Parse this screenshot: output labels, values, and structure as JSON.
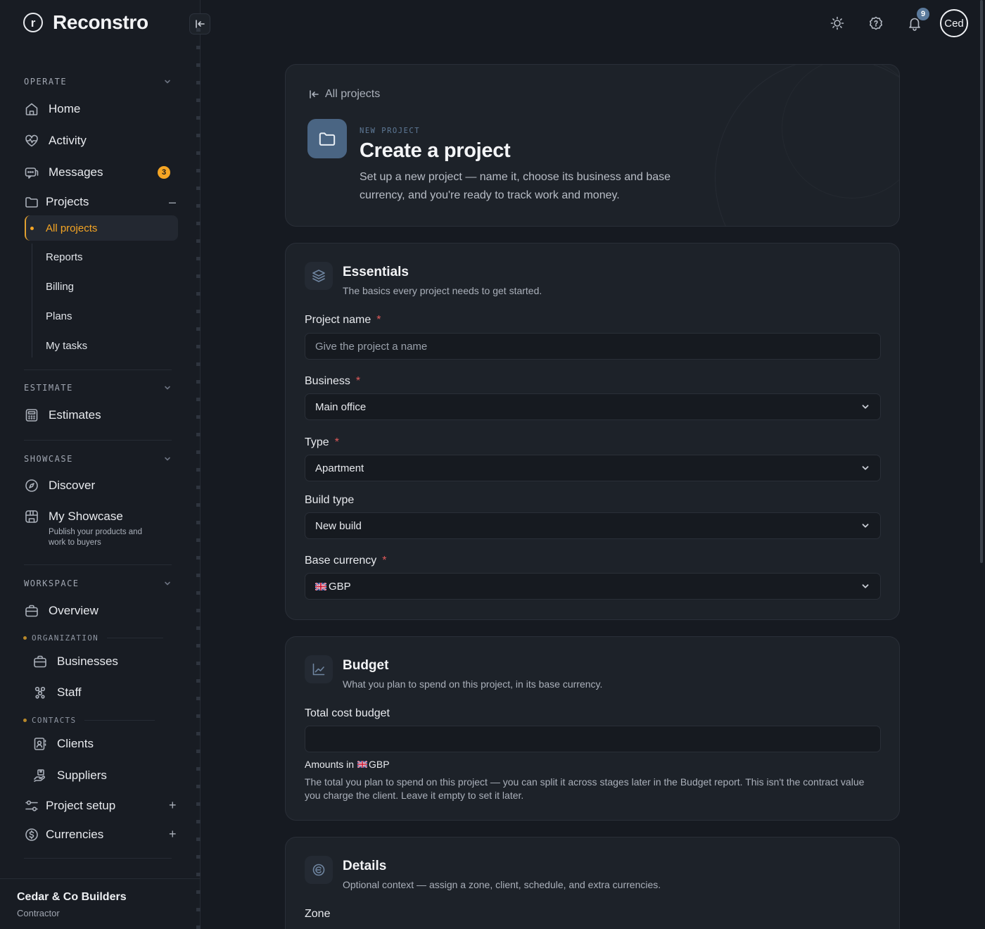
{
  "brand": {
    "name": "Reconstro",
    "logo_letter": "r"
  },
  "sidebar": {
    "sections": {
      "operate": "OPERATE",
      "estimate": "ESTIMATE",
      "showcase": "SHOWCASE",
      "workspace": "WORKSPACE"
    },
    "home": "Home",
    "activity": "Activity",
    "messages": {
      "label": "Messages",
      "badge": "3"
    },
    "projects": {
      "label": "Projects",
      "toggle": "–"
    },
    "projects_children": {
      "all_projects": "All projects",
      "reports": "Reports",
      "billing": "Billing",
      "plans": "Plans",
      "my_tasks": "My tasks"
    },
    "estimates": "Estimates",
    "discover": "Discover",
    "my_showcase": {
      "label": "My Showcase",
      "description": "Publish your products and work to buyers"
    },
    "overview": "Overview",
    "organization_head": "ORGANIZATION",
    "businesses": "Businesses",
    "staff": "Staff",
    "contacts_head": "CONTACTS",
    "clients": "Clients",
    "suppliers": "Suppliers",
    "project_setup": {
      "label": "Project setup",
      "toggle": "+"
    },
    "currencies": {
      "label": "Currencies",
      "toggle": "+"
    },
    "footer": {
      "org_name": "Cedar & Co Builders",
      "role": "Contractor"
    }
  },
  "topbar": {
    "notifications_count": "9",
    "avatar_text": "Ced"
  },
  "header_card": {
    "back_label": "All projects",
    "eyebrow": "NEW PROJECT",
    "title": "Create a project",
    "lead": "Set up a new project — name it, choose its business and base currency, and you're ready to track work and money."
  },
  "essentials": {
    "title": "Essentials",
    "subtitle": "The basics every project needs to get started.",
    "project_name": {
      "label": "Project name",
      "placeholder": "Give the project a name",
      "required": "*"
    },
    "business": {
      "label": "Business",
      "value": "Main office",
      "required": "*"
    },
    "type": {
      "label": "Type",
      "value": "Apartment",
      "required": "*"
    },
    "build_type": {
      "label": "Build type",
      "value": "New build"
    },
    "base_currency": {
      "label": "Base currency",
      "value": "GBP",
      "required": "*"
    }
  },
  "budget": {
    "title": "Budget",
    "subtitle": "What you plan to spend on this project, in its base currency.",
    "total_label": "Total cost budget",
    "total_value": "",
    "amounts_prefix": "Amounts in",
    "amounts_currency": "GBP",
    "help": "The total you plan to spend on this project — you can split it across stages later in the Budget report. This isn't the contract value you charge the client. Leave it empty to set it later."
  },
  "details": {
    "title": "Details",
    "subtitle": "Optional context — assign a zone, client, schedule, and extra currencies.",
    "zone_label": "Zone"
  },
  "colors": {
    "accent": "#f5a524",
    "brand_blue": "#4a6583",
    "required": "#e05a5a",
    "background": "#161a21"
  }
}
